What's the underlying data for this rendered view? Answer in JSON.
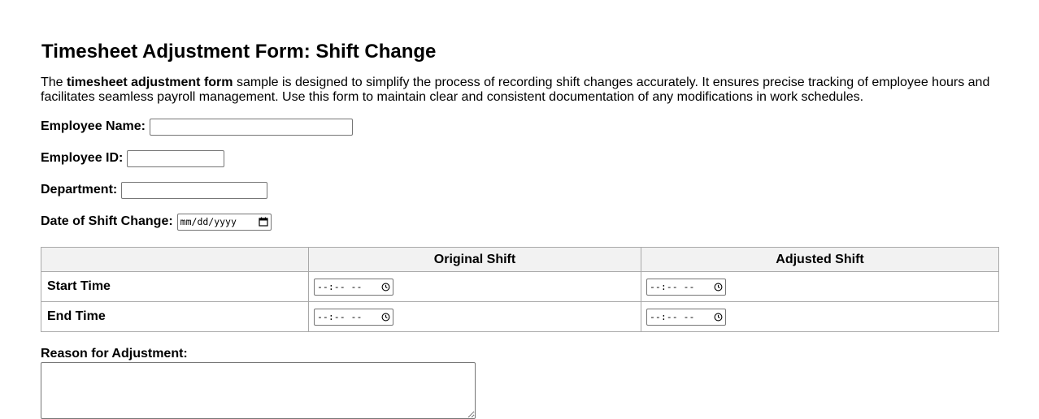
{
  "form": {
    "title": "Timesheet Adjustment Form: Shift Change",
    "intro": {
      "prefix": "The ",
      "bold": "timesheet adjustment form",
      "rest": " sample is designed to simplify the process of recording shift changes accurately. It ensures precise tracking of employee hours and facilitates seamless payroll management. Use this form to maintain clear and consistent documentation of any modifications in work schedules."
    },
    "fields": {
      "employee_name_label": "Employee Name:",
      "employee_name_value": "",
      "employee_id_label": "Employee ID:",
      "employee_id_value": "",
      "department_label": "Department:",
      "department_value": "",
      "date_label": "Date of Shift Change:",
      "date_placeholder": "mm/dd/yyyy"
    },
    "table": {
      "headers": [
        "",
        "Original Shift",
        "Adjusted Shift"
      ],
      "rows": [
        {
          "label": "Start Time",
          "original": "--:-- --",
          "adjusted": "--:-- --"
        },
        {
          "label": "End Time",
          "original": "--:-- --",
          "adjusted": "--:-- --"
        }
      ]
    },
    "reason_label": "Reason for Adjustment:",
    "reason_value": ""
  },
  "icons": {
    "date_picker": "calendar-icon",
    "time_picker": "clock-icon"
  }
}
